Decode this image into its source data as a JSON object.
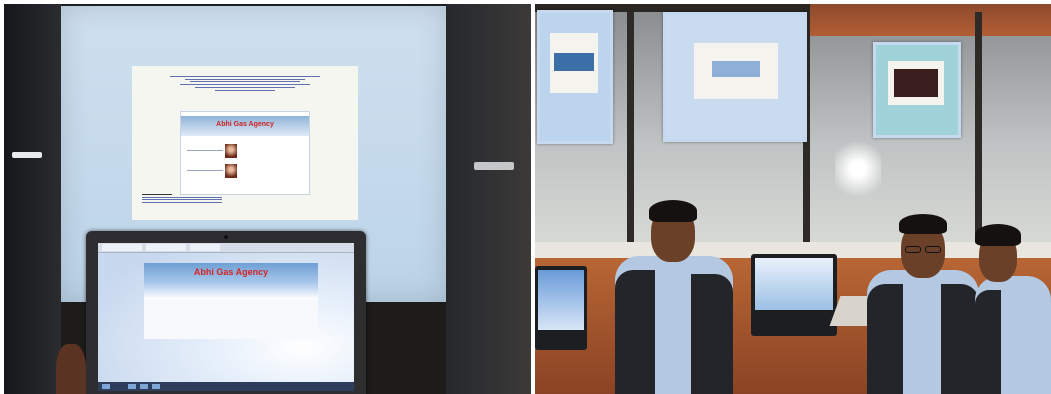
{
  "panels": {
    "left": {
      "projected_page": {
        "heading_lines": [
          "",
          "",
          "",
          "",
          "",
          ""
        ],
        "website_title": "Abhi Gas Agency",
        "footer_title": "",
        "footer_lines": [
          "",
          "",
          ""
        ]
      },
      "laptop": {
        "website_title": "Abhi Gas Agency"
      }
    },
    "right": {}
  },
  "colors": {
    "website_title_red": "#d62323",
    "projector_blue": "#c6dbee",
    "shirt_blue": "#b4c8e2",
    "wood_orange": "#b25e35"
  }
}
